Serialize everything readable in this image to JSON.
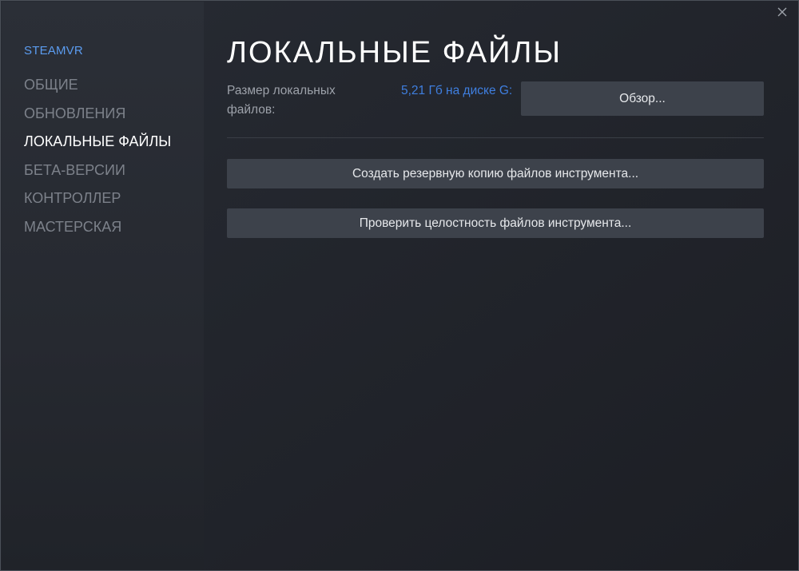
{
  "window": {
    "close_icon": "close-icon"
  },
  "sidebar": {
    "app_name": "STEAMVR",
    "items": [
      {
        "label": "ОБЩИЕ",
        "active": false
      },
      {
        "label": "ОБНОВЛЕНИЯ",
        "active": false
      },
      {
        "label": "ЛОКАЛЬНЫЕ ФАЙЛЫ",
        "active": true
      },
      {
        "label": "БЕТА-ВЕРСИИ",
        "active": false
      },
      {
        "label": "КОНТРОЛЛЕР",
        "active": false
      },
      {
        "label": "МАСТЕРСКАЯ",
        "active": false
      }
    ]
  },
  "main": {
    "title": "ЛОКАЛЬНЫЕ ФАЙЛЫ",
    "size_label": "Размер локальных файлов:",
    "size_value": "5,21 Гб на диске G:",
    "browse_label": "Обзор...",
    "backup_label": "Создать резервную копию файлов инструмента...",
    "verify_label": "Проверить целостность файлов инструмента..."
  },
  "colors": {
    "accent": "#5b9cf0",
    "link": "#3f7fe0",
    "active_nav": "#ffffff",
    "inactive_nav": "#7c818a",
    "button_bg": "#3d424b"
  }
}
